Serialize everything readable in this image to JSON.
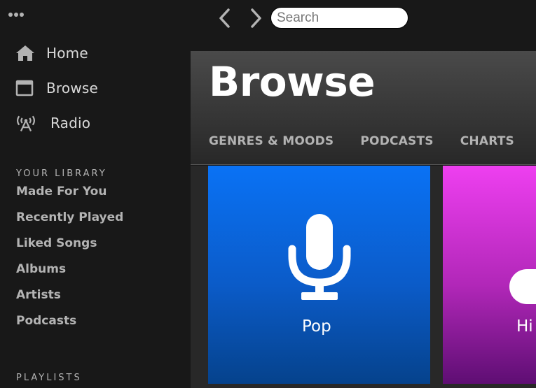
{
  "sidebar": {
    "nav": [
      {
        "label": "Home",
        "icon": "home-icon"
      },
      {
        "label": "Browse",
        "icon": "browse-icon"
      },
      {
        "label": "Radio",
        "icon": "radio-icon"
      }
    ],
    "library_title": "YOUR LIBRARY",
    "library": [
      "Made For You",
      "Recently Played",
      "Liked Songs",
      "Albums",
      "Artists",
      "Podcasts"
    ],
    "playlists_title": "PLAYLISTS"
  },
  "topbar": {
    "search_placeholder": "Search",
    "icons": [
      "menu-dots-icon",
      "back-arrow-icon",
      "forward-arrow-icon"
    ]
  },
  "main": {
    "title": "Browse",
    "tabs": [
      "GENRES & MOODS",
      "PODCASTS",
      "CHARTS"
    ],
    "cards": [
      {
        "label": "Pop",
        "icon": "microphone-icon",
        "color_top": "#0a72f5",
        "color_bottom": "#05428c"
      },
      {
        "label": "Hi",
        "icon": "music-note-icon",
        "color_top": "#ee3ff0",
        "color_bottom": "#5e0e73"
      }
    ]
  },
  "colors": {
    "background": "#181818",
    "text_primary": "#ffffff",
    "text_secondary": "#b3b3b3"
  }
}
